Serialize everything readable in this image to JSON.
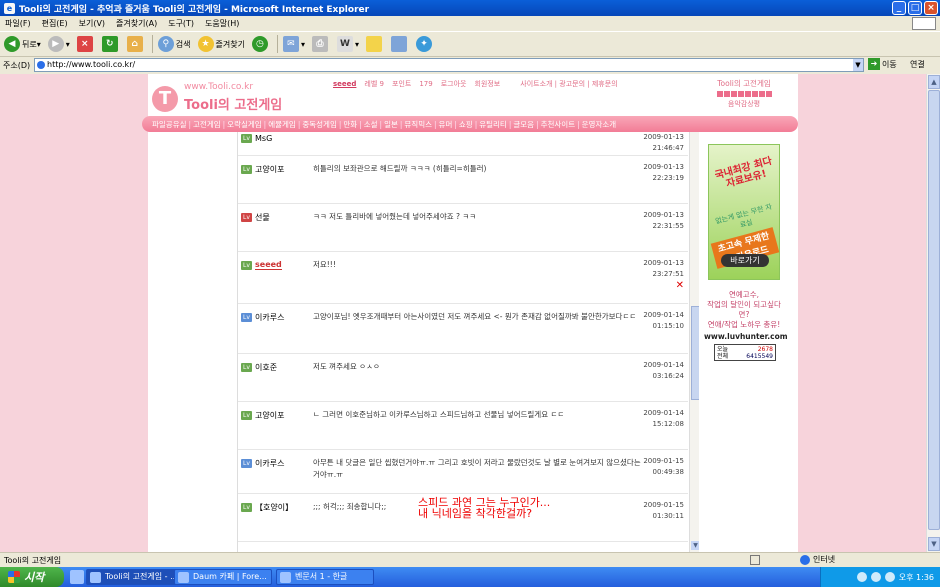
{
  "window": {
    "title": "Tooli의 고전게임 - 추억과 즐거움 Tooli의 고전게임 - Microsoft Internet Explorer"
  },
  "menu": [
    "파일(F)",
    "편집(E)",
    "보기(V)",
    "즐겨찾기(A)",
    "도구(T)",
    "도움말(H)"
  ],
  "toolbar": {
    "back": "뒤로",
    "search": "검색",
    "favorites": "즐겨찾기"
  },
  "address": {
    "label": "주소(D)",
    "url": "http://www.tooli.co.kr/",
    "go": "이동",
    "links": "연결"
  },
  "site": {
    "logo_url": "www.Tooli.co.kr",
    "logo_name": "Tooli의 고전게임",
    "user": {
      "nick": "seeed",
      "level_label": "레벨",
      "level": "9",
      "point_label": "포인트",
      "points": "179",
      "logout": "로그아웃",
      "member_info": "회원정보",
      "links": "사이트소개 | 광고문의 | 제휴문의"
    },
    "right_title": "Tooli의 고전게임",
    "right_sub": "음악감상평",
    "nav": [
      "파일공유실",
      "고전게임",
      "오락실게임",
      "에뮬게임",
      "중독성게임",
      "만화",
      "소설",
      "일본",
      "뮤직믹스",
      "유머",
      "쇼핑",
      "유틸리티",
      "글모음",
      "추천사이트",
      "운영자소개"
    ]
  },
  "comments": [
    {
      "name": "MsG",
      "level_color": "green",
      "msg": "",
      "date": "2009-01-13",
      "time": "21:46:47"
    },
    {
      "name": "고양이포",
      "level_color": "green",
      "msg": "히틀리의 보좌관으로 해드릴까 ㅋㅋㅋ (히틀리=히틀러)",
      "date": "2009-01-13",
      "time": "22:23:19"
    },
    {
      "name": "선물",
      "level_color": "red",
      "msg": "ㅋㅋ 저도 틀리바에 넣어줬는데 넣어주세야죠 ? ㅋㅋ",
      "date": "2009-01-13",
      "time": "22:31:55"
    },
    {
      "name": "seeed",
      "level_color": "green",
      "msg": "저요!!!",
      "date": "2009-01-13",
      "time": "23:27:51",
      "deletable": true
    },
    {
      "name": "이카루스",
      "level_color": "blue",
      "msg": "고양이포님! 옛우조개때부터 아는사이였던 저도 껴주세요 <- 뭔가 존재감 없어질까봐 불안한가보다ㄷㄷ",
      "date": "2009-01-14",
      "time": "01:15:10"
    },
    {
      "name": "이호준",
      "level_color": "green",
      "msg": "저도 껴주세요 ㅇㅅㅇ",
      "date": "2009-01-14",
      "time": "03:16:24"
    },
    {
      "name": "고양이포",
      "level_color": "green",
      "msg": "ㄴ 그러면 이호준님하고 이카루스님하고 스피드님하고 선물님 넣어드릴게요 ㄷㄷ",
      "date": "2009-01-14",
      "time": "15:12:08"
    },
    {
      "name": "이카루스",
      "level_color": "blue",
      "msg": "아무튼 내 닷글은 일단 씹혔던거야ㅠ.ㅠ 그리고 호빗이 저라고 물랐던것도 날 별로 눈여겨보지 않으셨다는거야ㅠ.ㅠ",
      "date": "2009-01-15",
      "time": "00:49:38"
    },
    {
      "name": "【호양이】",
      "level_color": "green",
      "msg": ";;; 허걱;;; 죄송합니다;;",
      "date": "2009-01-15",
      "time": "01:30:11"
    }
  ],
  "overlay": {
    "line1": "스피드 과연 그는 누구인가...",
    "line2": "내 닉네임을 착각한걸까?"
  },
  "ad": {
    "headline": "국내최강 최다 자료보유!",
    "sub": "없는게 없는 무한 자료실",
    "banner": "초고속 무제한 쾌 다운로드",
    "button": "바로가기",
    "text1": "연예고수,",
    "text2": "작업의 달인이 되고싶다면?",
    "text3": "연애/작업 노하우 총유!",
    "url": "www.luvhunter.com"
  },
  "counter": {
    "today_label": "오늘",
    "today": "2678",
    "total_label": "전체",
    "total": "6415549"
  },
  "status": {
    "text": "Tooli의 고전게임",
    "zone": "인터넷"
  },
  "taskbar": {
    "start": "시작",
    "tasks": [
      "Tooli의 고전게임 - ...",
      "Daum 카페 | Fore...",
      "벤문서 1 - 한글"
    ],
    "clock": "오후 1:36"
  }
}
